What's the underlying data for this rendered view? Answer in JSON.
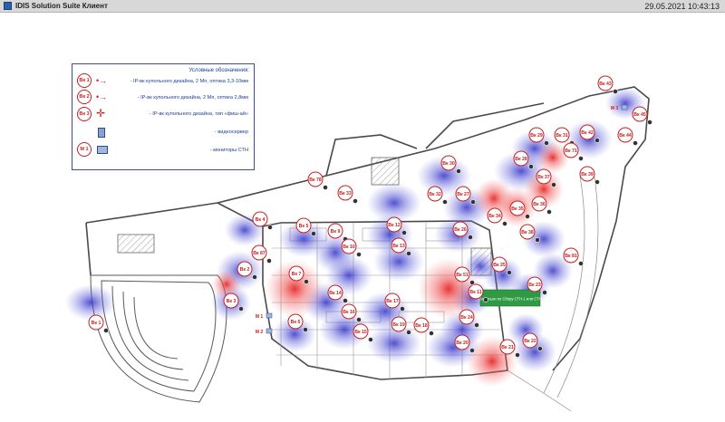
{
  "window": {
    "title": "IDIS Solution Suite Клиент",
    "datetime": "29.05.2021 10:43:13"
  },
  "legend": {
    "title": "Условные обозначения:",
    "items": [
      {
        "badge": "Вк 1",
        "text": "- IP-вк купольного дизайна, 2 Мп, оптика 3,3-10мм"
      },
      {
        "badge": "Вк 2",
        "text": "- IP-вк купольного дизайна, 2 Мп, оптика 2,8мм"
      },
      {
        "badge": "Вк 3",
        "text": "- IP-вк купольного дизайна, тип «фиш-ай»"
      },
      {
        "badge": "",
        "text": "- видеосервер"
      },
      {
        "badge": "М 1",
        "text": "- мониторы СТН"
      }
    ]
  },
  "plan": {
    "sign_text": "Павильон по Сбору СТН-1 или СТН",
    "cameras": [
      {
        "label": "Вк 1",
        "type": "zoom"
      },
      {
        "label": "Вк 2",
        "type": "zoom"
      },
      {
        "label": "Вк 3",
        "type": "zoom"
      },
      {
        "label": "Вк 4",
        "type": "zoom"
      },
      {
        "label": "Вк 5",
        "type": "zoom"
      },
      {
        "label": "Вк 6",
        "type": "zoom"
      },
      {
        "label": "Вк 7",
        "type": "zoom"
      },
      {
        "label": "Вк 9",
        "type": "zoom"
      },
      {
        "label": "Вк 10",
        "type": "zoom"
      },
      {
        "label": "Вк 11",
        "type": "zoom"
      },
      {
        "label": "Вк 12",
        "type": "zoom"
      },
      {
        "label": "Вк 13",
        "type": "zoom"
      },
      {
        "label": "Вк 14",
        "type": "zoom"
      },
      {
        "label": "Вк 15",
        "type": "zoom"
      },
      {
        "label": "Вк 16",
        "type": "zoom"
      },
      {
        "label": "Вк 17",
        "type": "zoom"
      },
      {
        "label": "Вк 18",
        "type": "zoom"
      },
      {
        "label": "Вк 19",
        "type": "zoom"
      },
      {
        "label": "Вк 20",
        "type": "zoom"
      },
      {
        "label": "Вк 21",
        "type": "fisheye"
      },
      {
        "label": "Вк 22",
        "type": "zoom"
      },
      {
        "label": "Вк 23",
        "type": "zoom"
      },
      {
        "label": "Вк 24",
        "type": "zoom"
      },
      {
        "label": "Вк 25",
        "type": "zoom"
      },
      {
        "label": "Вк 26",
        "type": "zoom"
      },
      {
        "label": "Вк 27",
        "type": "zoom"
      },
      {
        "label": "Вк 28",
        "type": "zoom"
      },
      {
        "label": "Вк 29",
        "type": "zoom"
      },
      {
        "label": "Вк 30",
        "type": "zoom"
      },
      {
        "label": "Вк 31",
        "type": "fisheye"
      },
      {
        "label": "Вк 32",
        "type": "zoom"
      },
      {
        "label": "Вк 33",
        "type": "zoom"
      },
      {
        "label": "Вк 34",
        "type": "fisheye"
      },
      {
        "label": "Вк 35",
        "type": "fisheye"
      },
      {
        "label": "Вк 36",
        "type": "zoom"
      },
      {
        "label": "Вк 37",
        "type": "fisheye"
      },
      {
        "label": "Вк 38",
        "type": "zoom"
      },
      {
        "label": "Вк 39",
        "type": "zoom"
      },
      {
        "label": "Вк 42",
        "type": "zoom"
      },
      {
        "label": "Вк 43",
        "type": "zoom"
      },
      {
        "label": "Вк 44",
        "type": "zoom"
      },
      {
        "label": "Вк 45",
        "type": "zoom"
      },
      {
        "label": "Вк 51",
        "type": "fisheye"
      },
      {
        "label": "Вк 71",
        "type": "fisheye"
      },
      {
        "label": "Вк 78",
        "type": "zoom"
      },
      {
        "label": "Вк 81",
        "type": "zoom"
      },
      {
        "label": "Вк 87",
        "type": "zoom"
      }
    ],
    "monitors": [
      {
        "label": "М 1"
      },
      {
        "label": "М 2"
      },
      {
        "label": "М 3"
      }
    ]
  },
  "colors": {
    "wide_lens": "#3c3cd2",
    "fisheye_lens": "#e61e1e",
    "legend_text": "#1a3f9a",
    "badge": "#c62020"
  }
}
